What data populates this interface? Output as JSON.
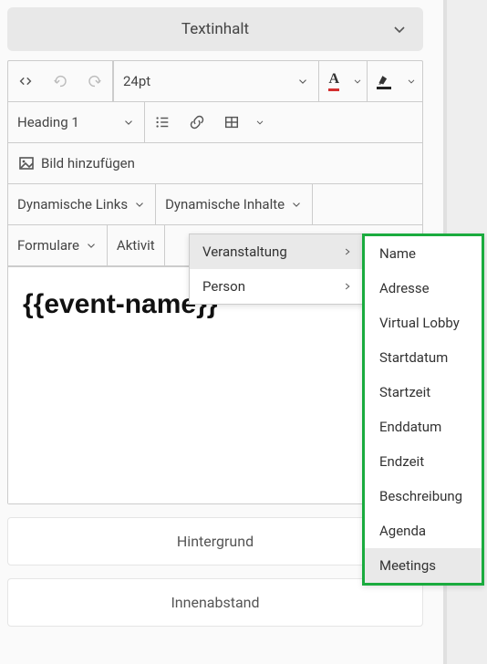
{
  "header": {
    "title": "Textinhalt"
  },
  "toolbar": {
    "font_size": "24pt",
    "heading": "Heading 1",
    "add_image": "Bild hinzufügen",
    "dyn_links": "Dynamische Links",
    "dyn_content": "Dynamische Inhalte",
    "forms": "Formulare",
    "activities_truncated": "Aktivit"
  },
  "editor": {
    "placeholder": "{{event-name}}"
  },
  "sections": {
    "background": "Hintergrund",
    "padding": "Innenabstand"
  },
  "dropdown": {
    "level1": [
      {
        "label": "Veranstaltung",
        "highlight": true
      },
      {
        "label": "Person",
        "highlight": false
      }
    ],
    "level2": [
      "Name",
      "Adresse",
      "Virtual Lobby",
      "Startdatum",
      "Startzeit",
      "Enddatum",
      "Endzeit",
      "Beschreibung",
      "Agenda",
      "Meetings"
    ],
    "level2_highlight_index": 9
  }
}
